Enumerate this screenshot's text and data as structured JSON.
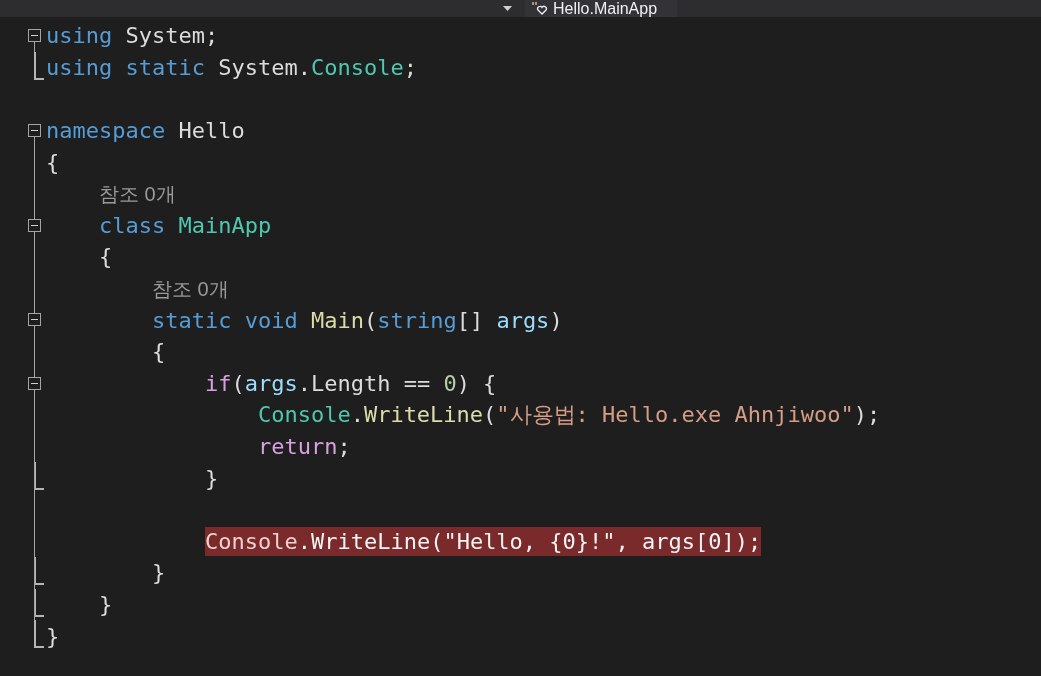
{
  "navigation_bar": {
    "member_dropdown": "Hello.MainApp"
  },
  "lines": [
    {
      "kind": "code",
      "collapsible": true,
      "block_end": false,
      "highlighted": false,
      "tokens": [
        {
          "kind": "keyword",
          "text": "using"
        },
        {
          "kind": "plain",
          "text": " System;"
        }
      ]
    },
    {
      "kind": "code",
      "collapsible": false,
      "block_end": true,
      "highlighted": false,
      "tokens": [
        {
          "kind": "keyword",
          "text": "using"
        },
        {
          "kind": "keyword",
          "text": " static"
        },
        {
          "kind": "plain",
          "text": " System."
        },
        {
          "kind": "type",
          "text": "Console"
        },
        {
          "kind": "plain",
          "text": ";"
        }
      ]
    },
    {
      "kind": "blank",
      "collapsible": false,
      "block_end": false
    },
    {
      "kind": "code",
      "collapsible": true,
      "block_end": false,
      "highlighted": false,
      "tokens": [
        {
          "kind": "keyword",
          "text": "namespace"
        },
        {
          "kind": "plain",
          "text": " Hello"
        }
      ]
    },
    {
      "kind": "code",
      "collapsible": false,
      "block_end": false,
      "highlighted": false,
      "tokens": [
        {
          "kind": "plain",
          "text": "{"
        }
      ]
    },
    {
      "kind": "codelens",
      "collapsible": false,
      "block_end": false,
      "text": "    참조 0개"
    },
    {
      "kind": "code",
      "collapsible": true,
      "block_end": false,
      "highlighted": false,
      "tokens": [
        {
          "kind": "keyword",
          "text": "    class"
        },
        {
          "kind": "type",
          "text": " MainApp"
        }
      ]
    },
    {
      "kind": "code",
      "collapsible": false,
      "block_end": false,
      "highlighted": false,
      "tokens": [
        {
          "kind": "plain",
          "text": "    {"
        }
      ]
    },
    {
      "kind": "codelens",
      "collapsible": false,
      "block_end": false,
      "text": "        참조 0개"
    },
    {
      "kind": "code",
      "collapsible": true,
      "block_end": false,
      "highlighted": false,
      "tokens": [
        {
          "kind": "keyword",
          "text": "        static"
        },
        {
          "kind": "keyword",
          "text": " void"
        },
        {
          "kind": "method",
          "text": " Main"
        },
        {
          "kind": "plain",
          "text": "("
        },
        {
          "kind": "keyword",
          "text": "string"
        },
        {
          "kind": "plain",
          "text": "[]"
        },
        {
          "kind": "param",
          "text": " args"
        },
        {
          "kind": "plain",
          "text": ")"
        }
      ]
    },
    {
      "kind": "code",
      "collapsible": false,
      "block_end": false,
      "highlighted": false,
      "tokens": [
        {
          "kind": "plain",
          "text": "        {"
        }
      ]
    },
    {
      "kind": "code",
      "collapsible": true,
      "block_end": false,
      "highlighted": false,
      "tokens": [
        {
          "kind": "control",
          "text": "            if"
        },
        {
          "kind": "plain",
          "text": "("
        },
        {
          "kind": "param",
          "text": "args"
        },
        {
          "kind": "plain",
          "text": ".Length == "
        },
        {
          "kind": "number",
          "text": "0"
        },
        {
          "kind": "plain",
          "text": ") {"
        }
      ]
    },
    {
      "kind": "code",
      "collapsible": false,
      "block_end": false,
      "highlighted": false,
      "tokens": [
        {
          "kind": "type",
          "text": "                Console"
        },
        {
          "kind": "plain",
          "text": "."
        },
        {
          "kind": "method",
          "text": "WriteLine"
        },
        {
          "kind": "plain",
          "text": "("
        },
        {
          "kind": "string",
          "text": "\"사용법: Hello.exe Ahnjiwoo\""
        },
        {
          "kind": "plain",
          "text": ");"
        }
      ]
    },
    {
      "kind": "code",
      "collapsible": false,
      "block_end": false,
      "highlighted": false,
      "tokens": [
        {
          "kind": "control",
          "text": "                return"
        },
        {
          "kind": "plain",
          "text": ";"
        }
      ]
    },
    {
      "kind": "code",
      "collapsible": false,
      "block_end": true,
      "highlighted": false,
      "tokens": [
        {
          "kind": "plain",
          "text": "            }"
        }
      ]
    },
    {
      "kind": "blank",
      "collapsible": false,
      "block_end": false
    },
    {
      "kind": "code",
      "collapsible": false,
      "block_end": false,
      "highlighted": true,
      "tokens": [
        {
          "kind": "type",
          "text": "            Console"
        },
        {
          "kind": "plain",
          "text": "."
        },
        {
          "kind": "method",
          "text": "WriteLine"
        },
        {
          "kind": "plain",
          "text": "("
        },
        {
          "kind": "string",
          "text": "\"Hello, {0}!\""
        },
        {
          "kind": "plain",
          "text": ", "
        },
        {
          "kind": "param",
          "text": "args"
        },
        {
          "kind": "plain",
          "text": "["
        },
        {
          "kind": "number",
          "text": "0"
        },
        {
          "kind": "plain",
          "text": "]);"
        }
      ]
    },
    {
      "kind": "code",
      "collapsible": false,
      "block_end": true,
      "highlighted": false,
      "tokens": [
        {
          "kind": "plain",
          "text": "        }"
        }
      ]
    },
    {
      "kind": "code",
      "collapsible": false,
      "block_end": true,
      "highlighted": false,
      "tokens": [
        {
          "kind": "plain",
          "text": "    }"
        }
      ]
    },
    {
      "kind": "code",
      "collapsible": false,
      "block_end": true,
      "highlighted": false,
      "tokens": [
        {
          "kind": "plain",
          "text": "}"
        }
      ]
    }
  ]
}
